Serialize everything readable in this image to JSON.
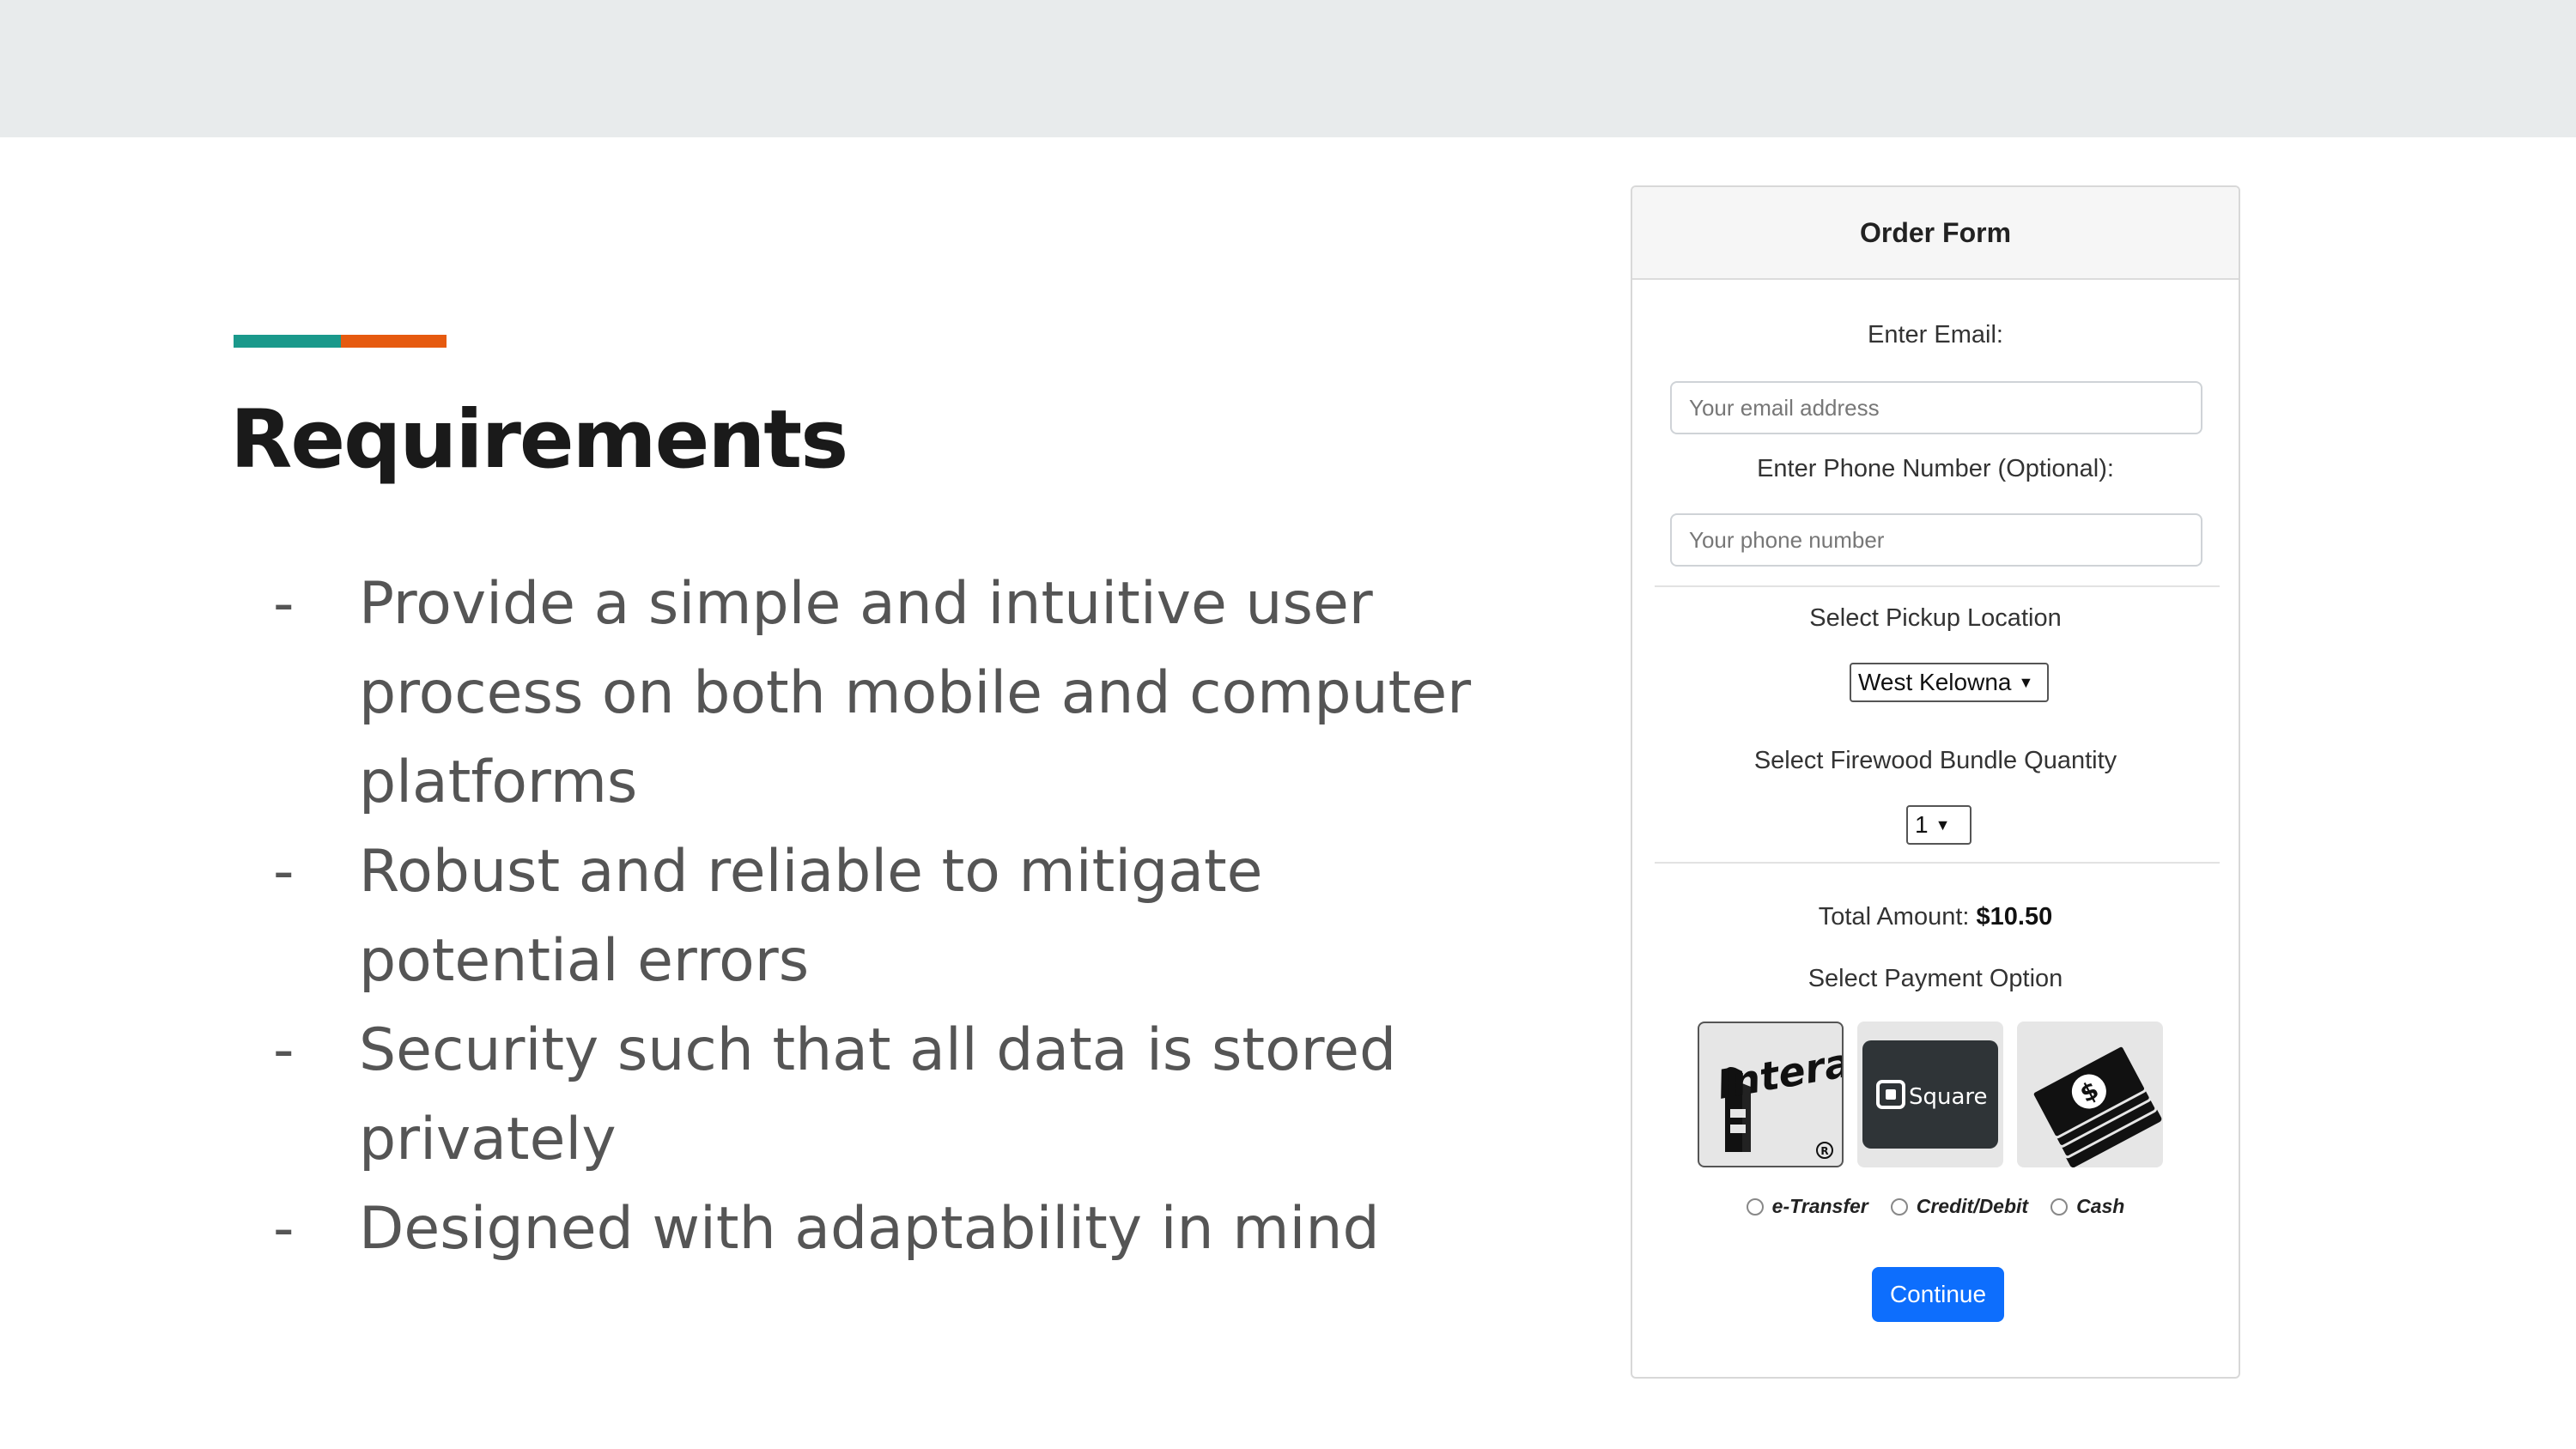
{
  "slide": {
    "title": "Requirements",
    "accent_colors": [
      "#1a998b",
      "#e65a0f"
    ],
    "bullet_marker": "-",
    "bullets": [
      "Provide a simple and intuitive user process on both mobile and computer platforms",
      "Robust and reliable to mitigate potential errors",
      "Security such that all data is stored privately",
      "Designed with adaptability in mind"
    ]
  },
  "order_form": {
    "title": "Order Form",
    "email_label": "Enter Email:",
    "email_placeholder": "Your email address",
    "phone_label": "Enter Phone Number (Optional):",
    "phone_placeholder": "Your phone number",
    "location_label": "Select Pickup Location",
    "location_selected": "West Kelowna",
    "quantity_label": "Select Firewood Bundle Quantity",
    "quantity_selected": "1",
    "total_label": "Total Amount:",
    "total_value": "$10.50",
    "payment_label": "Select Payment Option",
    "payment_options": [
      {
        "label": "e-Transfer",
        "icon": "interac-logo-icon"
      },
      {
        "label": "Credit/Debit",
        "icon": "square-logo-icon"
      },
      {
        "label": "Cash",
        "icon": "cash-stack-icon"
      }
    ],
    "interac_logo_text": "Interac",
    "square_logo_text": "Square",
    "continue_label": "Continue",
    "button_color": "#0d6efd"
  }
}
